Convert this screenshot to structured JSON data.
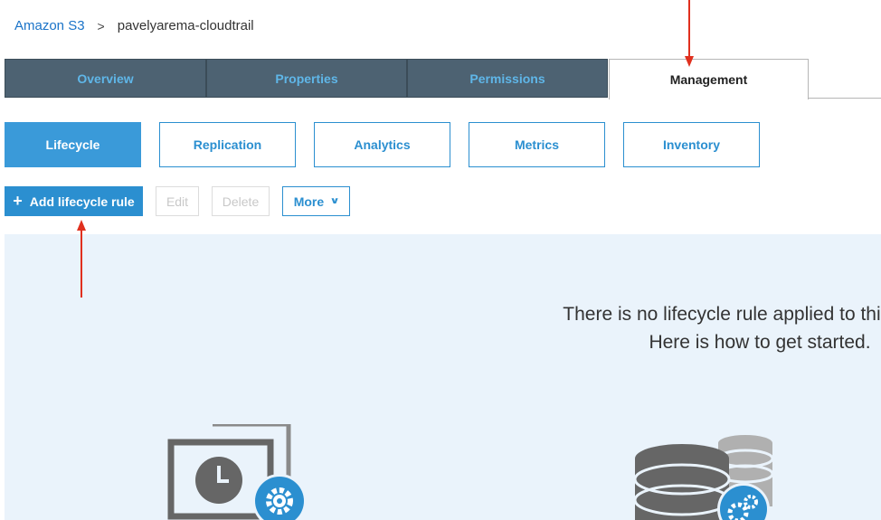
{
  "breadcrumb": {
    "root": "Amazon S3",
    "separator": ">",
    "current": "pavelyarema-cloudtrail"
  },
  "tabs": [
    {
      "label": "Overview",
      "active": false
    },
    {
      "label": "Properties",
      "active": false
    },
    {
      "label": "Permissions",
      "active": false
    },
    {
      "label": "Management",
      "active": true
    }
  ],
  "subtabs": [
    {
      "label": "Lifecycle",
      "active": true
    },
    {
      "label": "Replication",
      "active": false
    },
    {
      "label": "Analytics",
      "active": false
    },
    {
      "label": "Metrics",
      "active": false
    },
    {
      "label": "Inventory",
      "active": false
    }
  ],
  "toolbar": {
    "add_label": "Add lifecycle rule",
    "edit_label": "Edit",
    "delete_label": "Delete",
    "more_label": "More"
  },
  "empty_state": {
    "line1": "There is no lifecycle rule applied to this bucket.",
    "line2": "Here is how to get started."
  },
  "icons": {
    "add": "plus-icon",
    "more": "chevron-down-icon",
    "illustration_left": "clock-monitor-gear-icon",
    "illustration_right": "database-gear-icon"
  },
  "colors": {
    "accent": "#2b8fd0",
    "tab_bg": "#4d6272",
    "tab_text": "#5fb6e8",
    "panel_bg": "#eaf3fb",
    "annotation_arrow": "#e0301e"
  }
}
